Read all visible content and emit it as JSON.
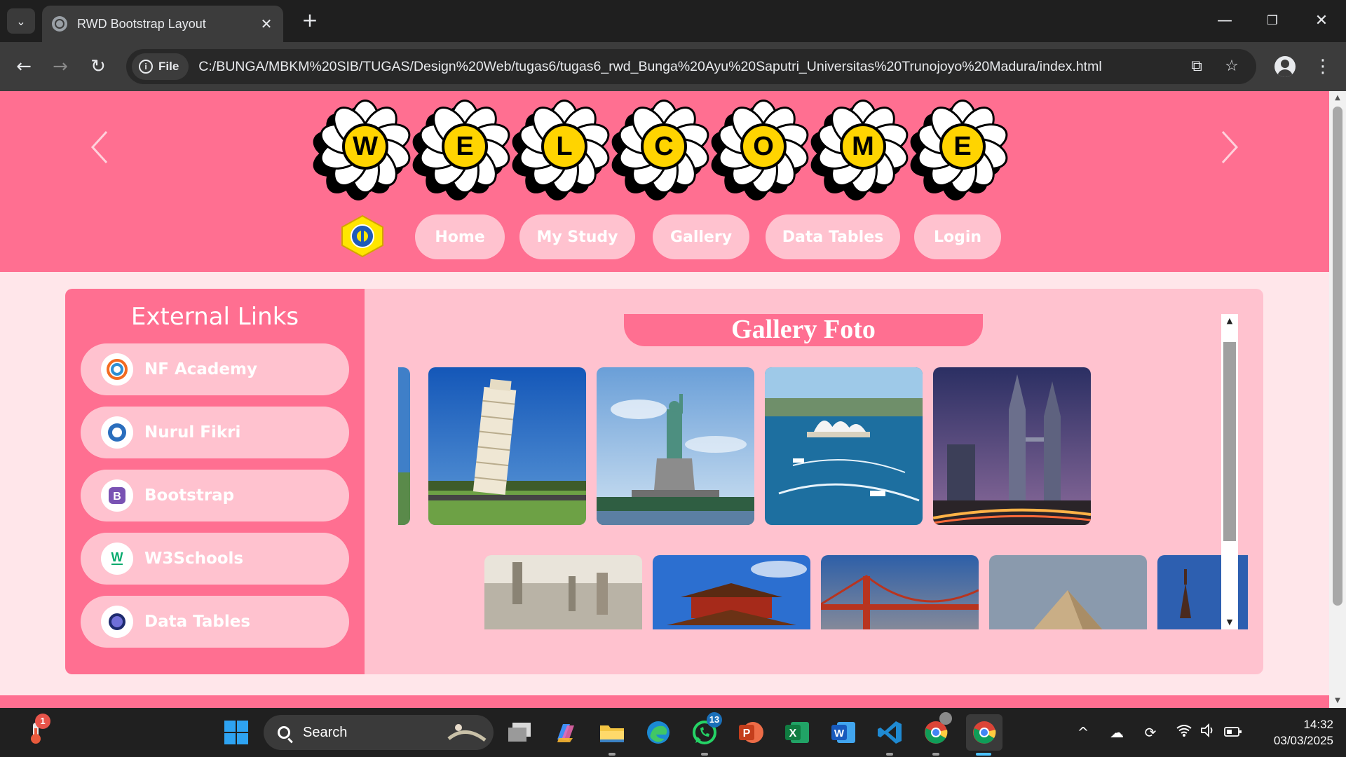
{
  "browser": {
    "tab_title": "RWD Bootstrap Layout",
    "new_tab_symbol": "+",
    "site_chip": "File",
    "url": "C:/BUNGA/MBKM%20SIB/TUGAS/Design%20Web/tugas6/tugas6_rwd_Bunga%20Ayu%20Saputri_Universitas%20Trunojoyo%20Madura/index.html"
  },
  "page": {
    "welcome_letters": [
      "W",
      "E",
      "L",
      "C",
      "O",
      "M",
      "E"
    ],
    "nav": [
      "Home",
      "My Study",
      "Gallery",
      "Data Tables",
      "Login"
    ],
    "sidebar": {
      "title": "External Links",
      "links": [
        "NF Academy",
        "Nurul Fikri",
        "Bootstrap",
        "W3Schools",
        "Data Tables"
      ]
    },
    "gallery": {
      "title": "Gallery Foto",
      "row1_subjects": [
        "Leaning Tower of Pisa",
        "Statue of Liberty",
        "Sydney Harbour",
        "Petronas Towers"
      ],
      "row2_subjects": [
        "City skyline",
        "Forbidden City",
        "Golden Gate Bridge",
        "Pyramid",
        "Tower"
      ]
    },
    "colors": {
      "hero_pink": "#ff6f91",
      "light_pink": "#ffc2cf",
      "page_bg": "#ffe6ea",
      "flower_center": "#ffd400"
    }
  },
  "taskbar": {
    "search_label": "Search",
    "thermo_badge": "1",
    "whatsapp_badge": "13",
    "time": "14:32",
    "date": "03/03/2025",
    "apps": [
      "start-icon",
      "search",
      "task-view-icon",
      "copilot-icon",
      "file-explorer-icon",
      "edge-icon",
      "whatsapp-icon",
      "powerpoint-icon",
      "excel-icon",
      "word-icon",
      "vscode-icon",
      "chrome-icon",
      "chrome-icon"
    ],
    "ppt_letter": "P",
    "excel_letter": "X",
    "word_letter": "W"
  }
}
